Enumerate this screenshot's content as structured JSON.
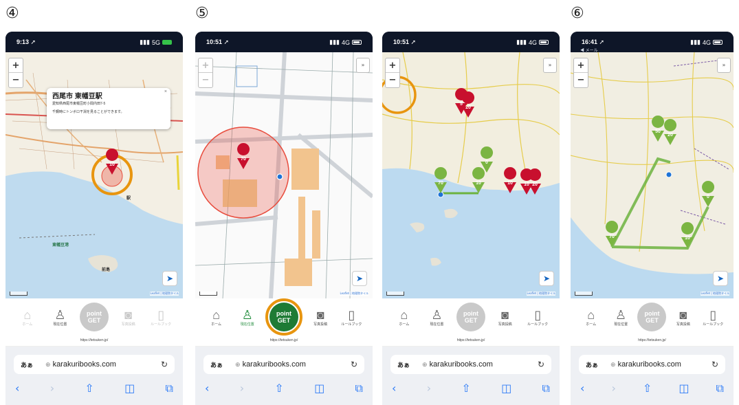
{
  "step_labels": [
    "④",
    "⑤",
    "⑥"
  ],
  "phones": [
    {
      "time": "9:13",
      "network": "5G",
      "nav_state": "all-faded-but-pin"
    },
    {
      "time": "10:51",
      "network": "4G"
    },
    {
      "time": "10:51",
      "network": "4G"
    },
    {
      "time": "16:41",
      "network": "4G",
      "sub_status": "◀ メール"
    }
  ],
  "popup": {
    "title": "西尾市 東幡豆駅",
    "address": "愛知県西尾市東幡豆町小間内田7-5",
    "note": "千鋼時にトンボロ干潟を見ることができます。",
    "close": "×"
  },
  "map_labels": {
    "station": "駅",
    "port": "東幡豆港",
    "island": "前島"
  },
  "pins": {
    "p1": [
      "10"
    ],
    "p2": [
      "70"
    ],
    "p3": [
      "5",
      "20",
      "70",
      "10",
      "0",
      "10",
      "10",
      "20"
    ],
    "p4": [
      "50",
      "20",
      "0",
      "70",
      "10"
    ]
  },
  "zoom": {
    "plus": "+",
    "minus": "−"
  },
  "layer_btn": "»",
  "locate_icon": "➤",
  "attribution": "Leaflet | 地理院タイル",
  "nav": {
    "home": "ホーム",
    "location": "現在位置",
    "point_line1": "point",
    "point_line2": "GET",
    "photo": "写真投稿",
    "rulebook": "ルールブック"
  },
  "site_url": "https://tetsuken.jp/",
  "safari": {
    "aa": "あぁ",
    "domain": "karakuribooks.com",
    "lock": "🔒",
    "reload": "↻",
    "back": "‹",
    "forward": "›",
    "share": "⇧",
    "bookmarks": "📖",
    "tabs": "⧉"
  },
  "colors": {
    "pin_red": "#c8102e",
    "pin_green": "#7bb542",
    "route_green": "#6db33f",
    "circle_orange": "#e8950f",
    "range_red": "#e84c3d",
    "point_green": "#1e7b35"
  }
}
